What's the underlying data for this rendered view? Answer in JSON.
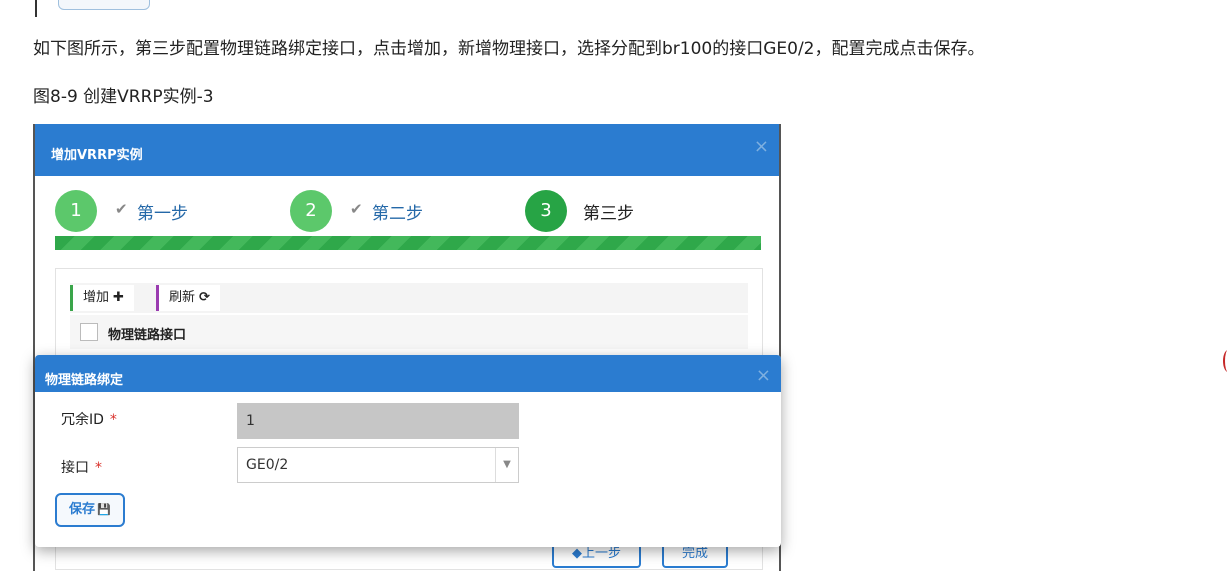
{
  "doc": {
    "paragraph": "如下图所示，第三步配置物理链路绑定接口，点击增加，新增物理接口，选择分配到br100的接口GE0/2，配置完成点击保存。",
    "caption": "图8-9 创建VRRP实例-3"
  },
  "wizard": {
    "title": "增加VRRP实例",
    "close": "×",
    "steps": [
      {
        "num": "1",
        "check": "✔",
        "label": "第一步"
      },
      {
        "num": "2",
        "check": "✔",
        "label": "第二步"
      },
      {
        "num": "3",
        "label": "第三步"
      }
    ],
    "progress": 1.0,
    "toolbar": {
      "add_label": "增加",
      "add_icon": "✚",
      "refresh_label": "刷新",
      "refresh_icon": "⟳"
    },
    "table": {
      "columns": [
        "物理链路接口"
      ]
    },
    "nav": {
      "prev_label": "◆上一步",
      "finish_label": "完成"
    }
  },
  "modal": {
    "title": "物理链路绑定",
    "close": "×",
    "fields": {
      "redundancy_label": "冗余ID",
      "redundancy_value": "1",
      "interface_label": "接口",
      "interface_value": "GE0/2",
      "required_mark": "*"
    },
    "save_label": "保存",
    "save_icon": "💾"
  },
  "colors": {
    "accent": "#2b7cd0",
    "step_done": "#5cc86b",
    "step_active": "#27a445",
    "required": "#d9302a"
  }
}
